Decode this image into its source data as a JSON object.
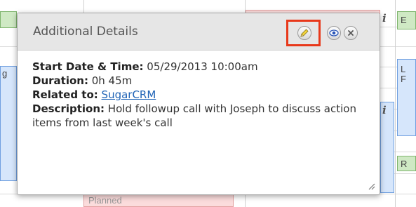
{
  "background": {
    "events": [
      {
        "label": "E"
      },
      {
        "label": "L"
      },
      {
        "label": "F"
      },
      {
        "label": "R"
      },
      {
        "label": "g"
      },
      {
        "label": "Planned"
      }
    ]
  },
  "popup": {
    "title": "Additional Details",
    "actions": {
      "edit_icon": "pencil-icon",
      "view_icon": "eye-icon",
      "close_icon": "close-icon",
      "highlight_color": "#e8381a"
    },
    "details": {
      "start_label": "Start Date & Time:",
      "start_value": "05/29/2013 10:00am",
      "duration_label": "Duration:",
      "duration_value": "0h 45m",
      "related_label": "Related to:",
      "related_value": "SugarCRM",
      "description_label": "Description:",
      "description_value": "Hold followup call with Joseph to discuss action items from last week's call"
    }
  }
}
